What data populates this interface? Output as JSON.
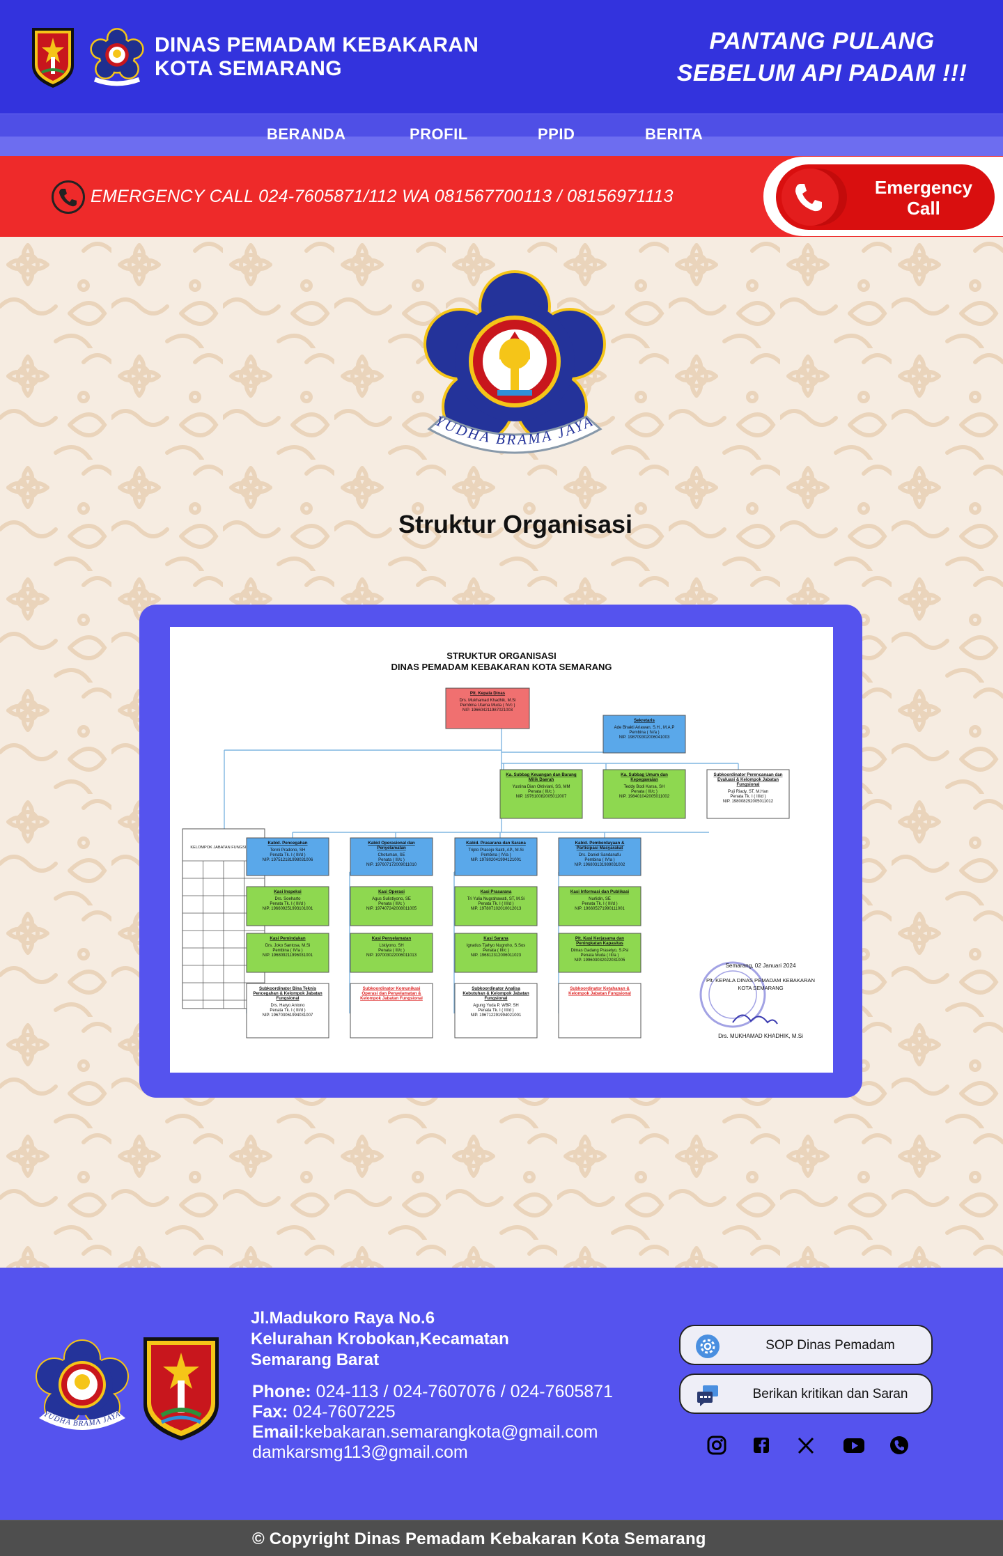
{
  "header": {
    "org_line1": "DINAS PEMADAM KEBAKARAN",
    "org_line2": "KOTA SEMARANG",
    "tagline_line1": "PANTANG PULANG",
    "tagline_line2": "SEBELUM API PADAM !!!"
  },
  "nav": {
    "items": [
      {
        "label": "BERANDA"
      },
      {
        "label": "PROFIL"
      },
      {
        "label": "PPID"
      },
      {
        "label": "BERITA"
      }
    ]
  },
  "emergency": {
    "text": "EMERGENCY CALL 024-7605871/112 WA 081567700113 / 08156971113",
    "button_line1": "Emergency",
    "button_line2": "Call"
  },
  "main": {
    "logo_motto": "YUDHA BRAMA JAYA",
    "title": "Struktur Organisasi"
  },
  "chart_doc": {
    "title1": "STRUKTUR ORGANISASI",
    "title2": "DINAS PEMADAM KEBAKARAN KOTA SEMARANG",
    "kepala": {
      "role": "Plt. Kepala Dinas",
      "name": "Drs. Mukhamad Khadhik, M.Si",
      "rank": "Pembina Utama Muda ( IV/c )",
      "nip": "NIP. 196604211987021003"
    },
    "sekretaris": {
      "role": "Sekretaris",
      "name": "Ade Bhakti Ariawan, S.H., M.A.P",
      "rank": "Pembina ( IV/a )",
      "nip": "NIP. 198709302006041003"
    },
    "subbag": [
      {
        "role": "Ka. Subbag Keuangan dan Barang Milik Daerah",
        "name": "Yustina Dian Oktiviani, SS, MM",
        "rank": "Penata ( III/c )",
        "nip": "NIP. 197610082005012007"
      },
      {
        "role": "Ka. Subbag Umum dan Kepegawaian",
        "name": "Teddy Bodi Karsa, SH",
        "rank": "Penata ( III/c )",
        "nip": "NIP. 198401042005011002"
      },
      {
        "role": "Subkoordinator Perencanaan dan Evaluasi & Kelompok Jabatan Fungsional",
        "name": "Puji Riady, ST, M.Han",
        "rank": "Penata Tk. I ( III/d )",
        "nip": "NIP. 198008292005011012"
      }
    ],
    "fungsional_label": "KELOMPOK JABATAN FUNGSIONAL",
    "kabid": [
      {
        "role": "Kabid. Pencegahan",
        "name": "Tenni Pradono, SH",
        "rank": "Penata Tk. I ( III/d )",
        "nip": "NIP. 197512181998031006"
      },
      {
        "role": "Kabid Operasional dan Penyelamatan",
        "name": "Chotuman, SE",
        "rank": "Penata ( III/c )",
        "nip": "NIP. 197607172009011010"
      },
      {
        "role": "Kabid. Prasarana dan Sarana",
        "name": "Tripto Prasojo Sakti, AP., M.Si",
        "rank": "Pembina ( IV/a )",
        "nip": "NIP. 197802041994121001"
      },
      {
        "role": "Kabid. Pemberdayaan & Partisipasi Masyarakat",
        "name": "Drs. Daniel Sandanafu",
        "rank": "Pembina ( IV/a )",
        "nip": "NIP. 196803131989031002"
      }
    ],
    "kasi1": [
      {
        "role": "Kasi Inspeksi",
        "name": "Drs. Soeharto",
        "rank": "Penata Tk. I ( III/d )",
        "nip": "NIP. 196609251993101001"
      },
      {
        "role": "Kasi Operasi",
        "name": "Agus Sulistiyono, SE",
        "rank": "Penata ( III/c )",
        "nip": "NIP. 197407242008011005"
      },
      {
        "role": "Kasi Prasarana",
        "name": "Tri Yulia Nugrahawati, ST, M.Si",
        "rank": "Penata Tk. I ( III/d )",
        "nip": "NIP. 197807102010012013"
      },
      {
        "role": "Kasi Informasi dan Publikasi",
        "name": "Nurlidin, SE",
        "rank": "Penata Tk. I ( III/d )",
        "nip": "NIP. 196605271990111001"
      }
    ],
    "kasi2": [
      {
        "role": "Kasi Pemindakan",
        "name": "Drs. Joko Santosa, M.Si",
        "rank": "Pembina ( IV/a )",
        "nip": "NIP. 196809211996031001"
      },
      {
        "role": "Kasi Penyelamatan",
        "name": "Listiyono, SH",
        "rank": "Penata ( III/c )",
        "nip": "NIP. 197003022006011013"
      },
      {
        "role": "Kasi Sarana",
        "name": "Ignatius Tjahyo Nugroho, S.Sos",
        "rank": "Penata ( III/c )",
        "nip": "NIP. 196812312006011023"
      },
      {
        "role": "Plt. Kasi Kerjasama dan Peningkatan Kapasitas",
        "name": "Dimas Gadang Prasetyo, S.Psi",
        "rank": "Penata Muda ( III/a )",
        "nip": "NIP. 199603032022031005"
      }
    ],
    "subkoor": [
      {
        "role": "Subkoordinator Bina Teknis Pencegahan & Kelompok Jabatan Fungsional",
        "name": "Drs. Haryo Antono",
        "rank": "Penata Tk. I ( III/d )",
        "nip": "NIP. 196703061994031007",
        "vacant": false
      },
      {
        "role": "Subkoordinator Komunikasi Operasi dan Penyelamatan & Kelompok Jabatan Fungsional",
        "name": "",
        "rank": "",
        "nip": "",
        "vacant": true
      },
      {
        "role": "Subkoordinator Analisa Kebutuhan & Kelompok Jabatan Fungsional",
        "name": "Agung Yuda P, WBP, SH",
        "rank": "Penata Tk. I ( III/d )",
        "nip": "NIP. 196712291994021001",
        "vacant": false
      },
      {
        "role": "Subkoordinator Ketahanan & Kelompok Jabatan Fungsional",
        "name": "",
        "rank": "",
        "nip": "",
        "vacant": true
      }
    ],
    "signature": {
      "date": "Semarang, 02 Januari 2024",
      "line1": "Plt. KEPALA DINAS PEMADAM KEBAKARAN",
      "line2": "KOTA SEMARANG",
      "name": "Drs. MUKHAMAD KHADHIK, M.Si"
    },
    "colors": {
      "kepala": "#f07070",
      "blue": "#5aa8ea",
      "green": "#8ed850",
      "line": "#7fb5e0"
    }
  },
  "footer": {
    "logo_motto": "YUDHA BRAMA JAYA",
    "address": [
      "Jl.Madukoro Raya No.6",
      "Kelurahan Krobokan,Kecamatan",
      "Semarang Barat"
    ],
    "phone_label": "Phone:",
    "phone": " 024-113 / 024-7607076 / 024-7605871",
    "fax_label": "Fax:",
    "fax": " 024-7607225",
    "email_label": "Email:",
    "email1": "kebakaran.semarangkota@gmail.com",
    "email2": "damkarsmg113@gmail.com",
    "btn_sop": "SOP Dinas Pemadam",
    "btn_saran": "Berikan kritikan dan Saran",
    "social": [
      "instagram-icon",
      "facebook-icon",
      "x-icon",
      "youtube-icon",
      "phone-icon"
    ]
  },
  "copyright": "© Copyright Dinas Pemadam Kebakaran Kota Semarang"
}
